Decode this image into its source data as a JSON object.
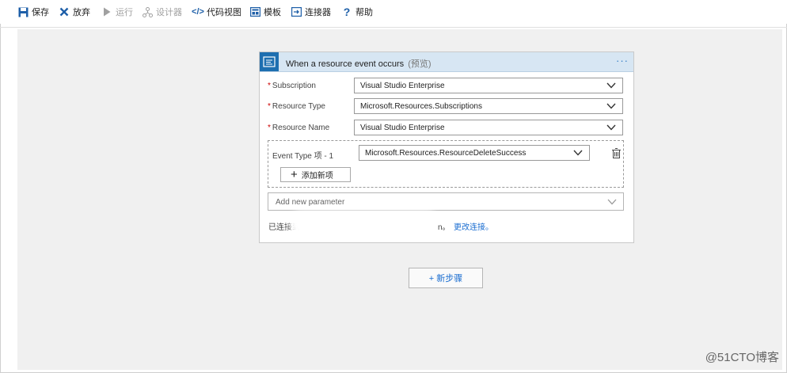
{
  "toolbar": {
    "save": "保存",
    "discard": "放弃",
    "run": "运行",
    "designer": "设计器",
    "code_view": "代码视图",
    "templates": "模板",
    "connectors": "连接器",
    "help": "帮助"
  },
  "trigger": {
    "title": "When a resource event occurs",
    "preview_tag": "(预览)",
    "more": "···",
    "fields": [
      {
        "label": "Subscription",
        "value": "Visual Studio Enterprise",
        "required_mark": "*"
      },
      {
        "label": "Resource Type",
        "value": "Microsoft.Resources.Subscriptions",
        "required_mark": "*"
      },
      {
        "label": "Resource Name",
        "value": "Visual Studio Enterprise",
        "required_mark": "*"
      }
    ],
    "event_type": {
      "label": "Event Type 项 - 1",
      "value": "Microsoft.Resources.ResourceDeleteSuccess"
    },
    "add_item_label": "添加新项",
    "add_param_placeholder": "Add new parameter",
    "connection": {
      "prefix": "已连接到",
      "suffix": "n。",
      "change_link": "更改连接。"
    }
  },
  "new_step_label": "+ 新步骤",
  "watermark": "@51CTO博客",
  "colors": {
    "accent": "#1e6fb0",
    "header_bg": "#d7e6f3",
    "canvas_bg": "#f0f0f0",
    "link": "#1a6dd0",
    "required": "#cc0000"
  }
}
